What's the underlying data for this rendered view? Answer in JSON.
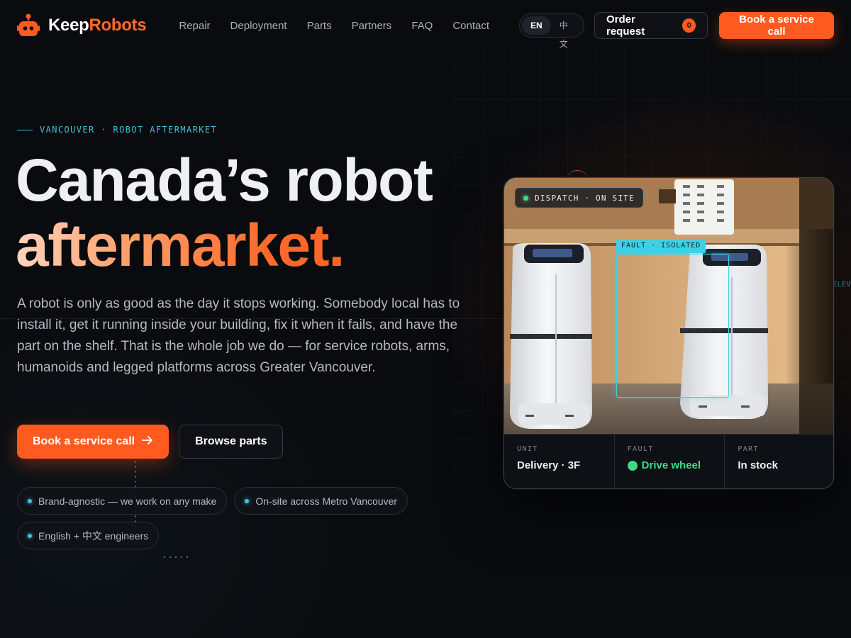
{
  "brand": {
    "name_part1": "Keep",
    "name_part2": "Robots",
    "accent": "#ff5a1f"
  },
  "nav": {
    "items": [
      "Repair",
      "Deployment",
      "Parts",
      "Partners",
      "FAQ",
      "Contact"
    ]
  },
  "lang": {
    "en": "EN",
    "zh": "中文",
    "active": "EN"
  },
  "header": {
    "order_label": "Order request",
    "order_count": "0",
    "cta_label": "Book a service call"
  },
  "hero": {
    "eyebrow": "VANCOUVER · ROBOT AFTERMARKET",
    "title_line1": "Canada’s robot",
    "title_line2": "aftermarket.",
    "lead": "A robot is only as good as the day it stops working. Somebody local has to install it, get it running inside your building, fix it when it fails, and have the part on the shelf. That is the whole job we do — for service robots, arms, humanoids and legged platforms across Greater Vancouver.",
    "cta_primary": "Book a service call",
    "cta_primary_icon": "arrow-right-icon",
    "cta_secondary": "Browse parts",
    "chips": [
      "Brand-agnostic — we work on any make",
      "On-site across Metro Vancouver",
      "English + 中文 engineers"
    ]
  },
  "card": {
    "status_badge": "DISPATCH · ON SITE",
    "fault_tag": "FAULT · ISOLATED",
    "side_tag": "ELEV-",
    "fields": [
      {
        "key": "UNIT",
        "value": "Delivery · 3F"
      },
      {
        "key": "FAULT",
        "value": "Drive wheel"
      },
      {
        "key": "PART",
        "value": "In stock"
      }
    ],
    "status_colors": {
      "ok": "#3ddc84",
      "highlight": "#3fd0e4"
    }
  }
}
